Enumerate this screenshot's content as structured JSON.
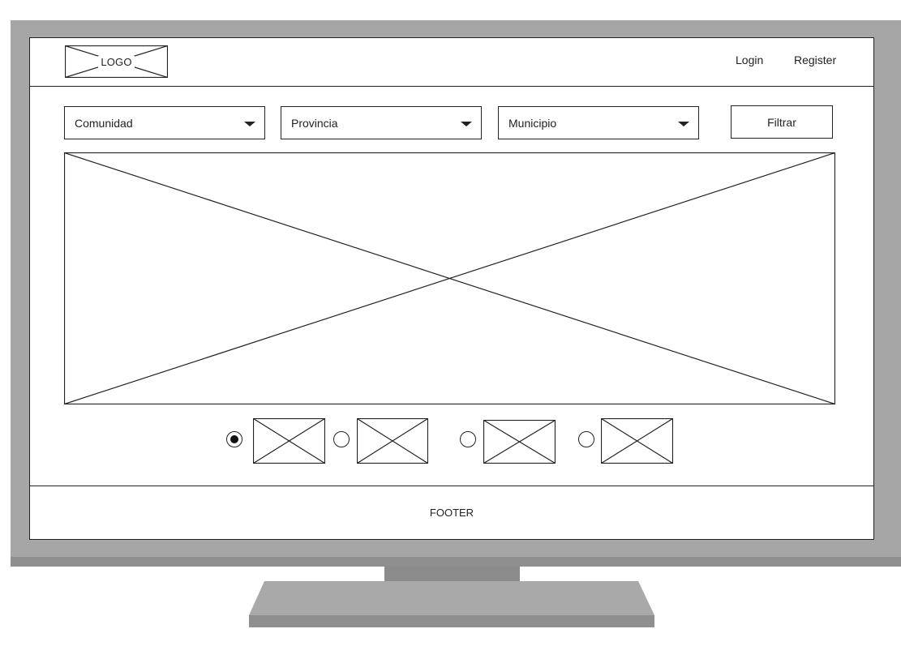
{
  "header": {
    "logo_text": "LOGO",
    "nav": {
      "login": "Login",
      "register": "Register"
    }
  },
  "filters": {
    "comunidad": "Comunidad",
    "provincia": "Provincia",
    "municipio": "Municipio",
    "filter_button": "Filtrar"
  },
  "carousel": {
    "selected_index": 0,
    "slide_count": 4
  },
  "footer": {
    "text": "FOOTER"
  },
  "icons": {
    "dropdown": "chevron-down-icon",
    "placeholder": "image-placeholder-icon"
  },
  "colors": {
    "frame": "#a6a6a6",
    "stand": "#8f8f8f",
    "stroke": "#222222"
  }
}
